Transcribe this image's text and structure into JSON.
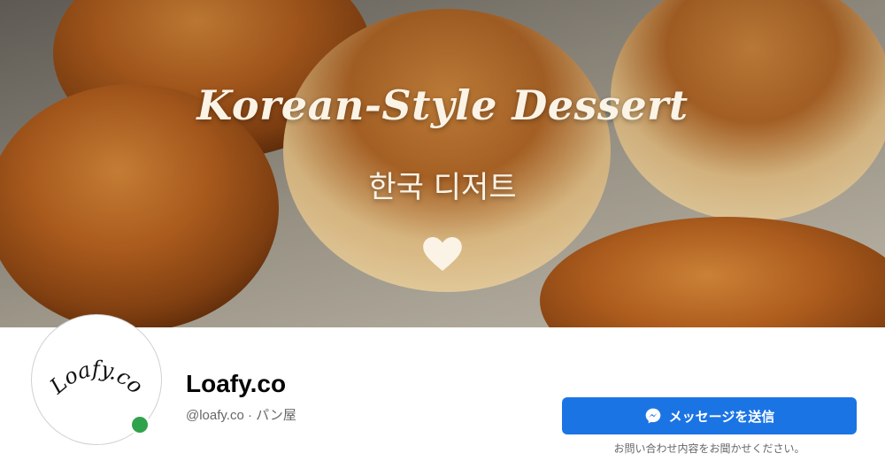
{
  "cover": {
    "title": "Korean-Style Dessert",
    "subtitle": "한국 디저트",
    "icon": "heart-icon"
  },
  "profile": {
    "avatar_text": "Loafy.co",
    "name": "Loafy.co",
    "handle_line": "@loafy.co · パン屋",
    "status": "online"
  },
  "actions": {
    "message_label": "メッセージを送信",
    "message_icon": "messenger-icon",
    "message_hint": "お問い合わせ内容をお聞かせください。"
  },
  "colors": {
    "brand_blue": "#1b74e4",
    "online_green": "#31a24c",
    "cover_text": "#fbf3e6"
  }
}
